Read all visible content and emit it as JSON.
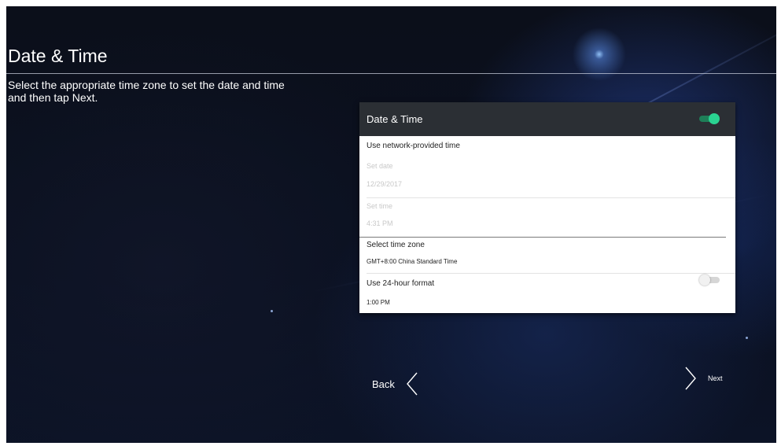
{
  "page": {
    "title": "Date & Time",
    "instructions": "Select the appropriate time zone to set the date and time and then tap Next."
  },
  "panel": {
    "title": "Date & Time",
    "auto_time_enabled": true,
    "network_time_label": "Use network-provided time",
    "set_date_label": "Set date",
    "set_date_value": "12/29/2017",
    "set_time_label": "Set time",
    "set_time_value": "4:31 PM",
    "time_zone_label": "Select time zone",
    "time_zone_value": "GMT+8:00 China Standard Time",
    "hour_format_label": "Use 24-hour format",
    "hour_format_enabled": false,
    "hour_format_sample": "1:00 PM"
  },
  "nav": {
    "back_label": "Back",
    "next_label": "Next"
  },
  "colors": {
    "toggle_on": "#2ad392",
    "header_bg": "#2b2f34"
  }
}
